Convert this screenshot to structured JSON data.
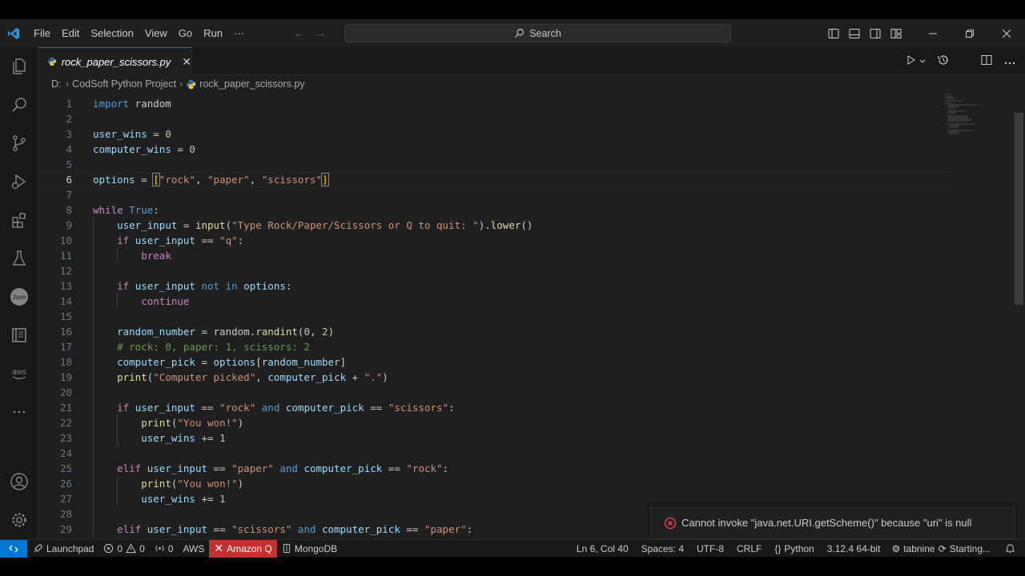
{
  "window": {
    "menu": [
      "File",
      "Edit",
      "Selection",
      "View",
      "Go",
      "Run",
      "···"
    ],
    "search_label": "Search"
  },
  "tab": {
    "label": "rock_paper_scissors.py",
    "close": "✕"
  },
  "breadcrumb": {
    "root": "D:",
    "folder": "CodSoft Python Project",
    "file": "rock_paper_scissors.py"
  },
  "code": {
    "lines": [
      {
        "n": "1",
        "html": "<span class='kw'>import</span> random"
      },
      {
        "n": "2",
        "html": ""
      },
      {
        "n": "3",
        "html": "<span class='var'>user_wins</span> = <span class='num'>0</span>"
      },
      {
        "n": "4",
        "html": "<span class='var'>computer_wins</span> = <span class='num'>0</span>"
      },
      {
        "n": "5",
        "html": ""
      },
      {
        "n": "6",
        "html": "<span class='var'>options</span> = <span class='bracket bracket-hl'>[</span><span class='str'>\"rock\"</span>, <span class='str'>\"paper\"</span>, <span class='str'>\"scissors\"</span><span class='bracket bracket-hl'>]</span>"
      },
      {
        "n": "7",
        "html": ""
      },
      {
        "n": "8",
        "html": "<span class='kc'>while</span> <span class='kw'>True</span>:"
      },
      {
        "n": "9",
        "html": "    <span class='var'>user_input</span> = <span class='fn'>input</span>(<span class='str'>\"Type Rock/Paper/Scissors or Q to quit: \"</span>).<span class='fn'>lower</span>()"
      },
      {
        "n": "10",
        "html": "    <span class='kc'>if</span> <span class='var'>user_input</span> == <span class='str'>\"q\"</span>:"
      },
      {
        "n": "11",
        "html": "        <span class='kc'>break</span>"
      },
      {
        "n": "12",
        "html": ""
      },
      {
        "n": "13",
        "html": "    <span class='kc'>if</span> <span class='var'>user_input</span> <span class='kw'>not</span> <span class='kw'>in</span> <span class='var'>options</span>:"
      },
      {
        "n": "14",
        "html": "        <span class='kc'>continue</span>"
      },
      {
        "n": "15",
        "html": ""
      },
      {
        "n": "16",
        "html": "    <span class='var'>random_number</span> = random.<span class='fn'>randint</span>(<span class='num'>0</span>, <span class='num'>2</span>)"
      },
      {
        "n": "17",
        "html": "    <span class='com'># rock: 0, paper: 1, scissors: 2</span>"
      },
      {
        "n": "18",
        "html": "    <span class='var'>computer_pick</span> = <span class='var'>options</span>[<span class='var'>random_number</span>]"
      },
      {
        "n": "19",
        "html": "    <span class='fn'>print</span>(<span class='str'>\"Computer picked\"</span>, <span class='var'>computer_pick</span> + <span class='str'>\".\"</span>)"
      },
      {
        "n": "20",
        "html": ""
      },
      {
        "n": "21",
        "html": "    <span class='kc'>if</span> <span class='var'>user_input</span> == <span class='str'>\"rock\"</span> <span class='kw'>and</span> <span class='var'>computer_pick</span> == <span class='str'>\"scissors\"</span>:"
      },
      {
        "n": "22",
        "html": "        <span class='fn'>print</span>(<span class='str'>\"You won!\"</span>)"
      },
      {
        "n": "23",
        "html": "        <span class='var'>user_wins</span> += <span class='num'>1</span>"
      },
      {
        "n": "24",
        "html": ""
      },
      {
        "n": "25",
        "html": "    <span class='kc'>elif</span> <span class='var'>user_input</span> == <span class='str'>\"paper\"</span> <span class='kw'>and</span> <span class='var'>computer_pick</span> == <span class='str'>\"rock\"</span>:"
      },
      {
        "n": "26",
        "html": "        <span class='fn'>print</span>(<span class='str'>\"You won!\"</span>)"
      },
      {
        "n": "27",
        "html": "        <span class='var'>user_wins</span> += <span class='num'>1</span>"
      },
      {
        "n": "28",
        "html": ""
      },
      {
        "n": "29",
        "html": "    <span class='kc'>elif</span> <span class='var'>user_input</span> == <span class='str'>\"scissors\"</span> <span class='kw'>and</span> <span class='var'>computer_pick</span> == <span class='str'>\"paper\"</span>:"
      }
    ],
    "active_line": "6"
  },
  "notification": {
    "message": "Cannot invoke \"java.net.URI.getScheme()\" because \"uri\" is null"
  },
  "statusbar": {
    "launchpad": "Launchpad",
    "errors": "0",
    "warnings": "0",
    "ports": "0",
    "aws": "AWS",
    "amazon_q": "Amazon Q",
    "mongodb": "MongoDB",
    "cursor_pos": "Ln 6, Col 40",
    "spaces": "Spaces: 4",
    "encoding": "UTF-8",
    "eol": "CRLF",
    "language": "Python",
    "interpreter": "3.12.4 64-bit",
    "tabnine": "tabnine",
    "starting": "Starting..."
  },
  "colors": {
    "accent": "#0078d4",
    "error_bg": "#c72e2e",
    "editor_bg": "#1f1f1f",
    "sidebar_bg": "#181818"
  },
  "activity_icons": [
    "explorer-icon",
    "search-icon",
    "source-control-icon",
    "run-debug-icon",
    "extensions-icon",
    "testing-icon",
    "json-icon",
    "book-icon",
    "aws-icon",
    "more-icon",
    "account-icon",
    "settings-icon"
  ]
}
